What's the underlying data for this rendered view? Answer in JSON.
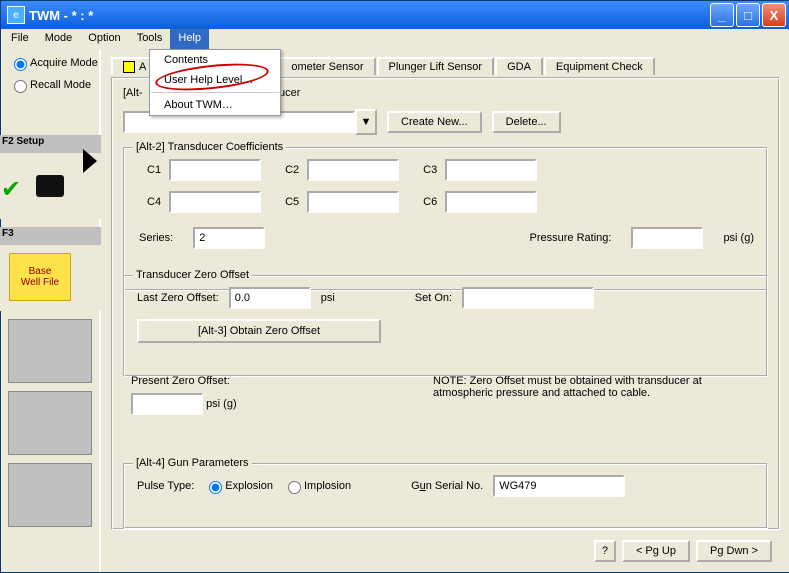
{
  "window": {
    "title": "TWM  -  * : *"
  },
  "menu": {
    "file": "File",
    "mode": "Mode",
    "option": "Option",
    "tools": "Tools",
    "help": "Help"
  },
  "help_menu": {
    "contents": "Contents",
    "userlevel": "User Help Level…",
    "about": "About TWM…"
  },
  "left": {
    "acquire": "Acquire Mode",
    "recall": "Recall Mode",
    "f2": "F2",
    "setup": "Setup",
    "f3": "F3",
    "base1": "Base",
    "base2": "Well File"
  },
  "tabs": {
    "a": "A",
    "dsensor": "ometer Sensor",
    "plunger": "Plunger Lift Sensor",
    "gda": "GDA",
    "equip": "Equipment Check"
  },
  "pt": {
    "alt1": "[Alt-",
    "suffix": "ucer",
    "createnew": "Create New...",
    "delete": "Delete..."
  },
  "coeff": {
    "legend": "[Alt-2]  Transducer Coefficients",
    "c1": "C1",
    "c2": "C2",
    "c3": "C3",
    "c4": "C4",
    "c5": "C5",
    "c6": "C6",
    "series": "Series:",
    "series_val": "2",
    "prate": "Pressure Rating:",
    "psig": "psi (g)"
  },
  "zero": {
    "legend": "Transducer Zero Offset",
    "lastzero": "Last Zero Offset:",
    "lastzero_val": "0.0",
    "psi": "psi",
    "seton": "Set On:",
    "obtain": "[Alt-3]  Obtain Zero Offset",
    "present": "Present Zero Offset:",
    "psig": "psi (g)",
    "note": "NOTE:  Zero Offset must be obtained with transducer at atmospheric pressure and attached to cable."
  },
  "gun": {
    "legend": "[Alt-4]  Gun Parameters",
    "ptype": "Pulse Type:",
    "explosion": "Explosion",
    "implosion": "Implosion",
    "gsn_pre": "G",
    "gsn_u": "u",
    "gsn_post": "n Serial No.",
    "gsn_val": "WG479"
  },
  "bottom": {
    "q": "?",
    "pgup": "< Pg Up",
    "pgdn": "Pg Dwn >"
  }
}
